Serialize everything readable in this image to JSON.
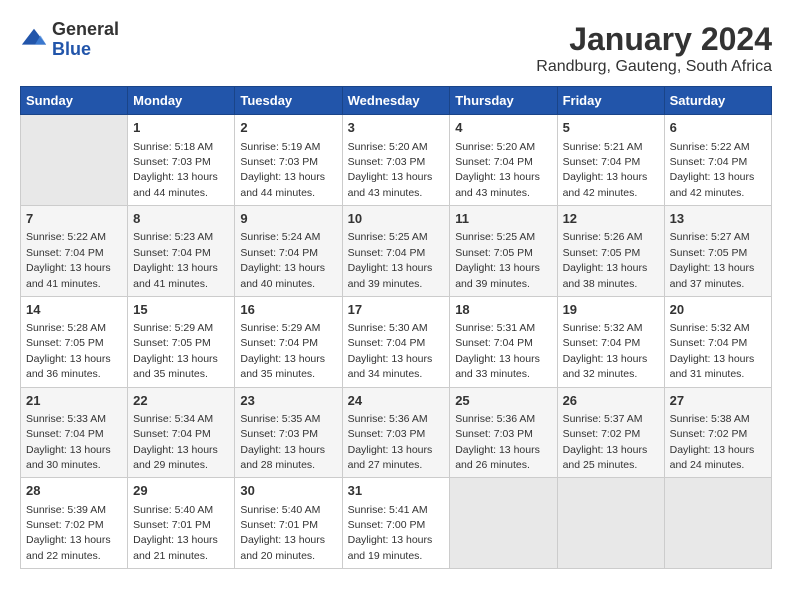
{
  "logo": {
    "general": "General",
    "blue": "Blue"
  },
  "title": "January 2024",
  "subtitle": "Randburg, Gauteng, South Africa",
  "days_header": [
    "Sunday",
    "Monday",
    "Tuesday",
    "Wednesday",
    "Thursday",
    "Friday",
    "Saturday"
  ],
  "weeks": [
    [
      {
        "day": "",
        "empty": true
      },
      {
        "day": "1",
        "sunrise": "Sunrise: 5:18 AM",
        "sunset": "Sunset: 7:03 PM",
        "daylight": "Daylight: 13 hours and 44 minutes."
      },
      {
        "day": "2",
        "sunrise": "Sunrise: 5:19 AM",
        "sunset": "Sunset: 7:03 PM",
        "daylight": "Daylight: 13 hours and 44 minutes."
      },
      {
        "day": "3",
        "sunrise": "Sunrise: 5:20 AM",
        "sunset": "Sunset: 7:03 PM",
        "daylight": "Daylight: 13 hours and 43 minutes."
      },
      {
        "day": "4",
        "sunrise": "Sunrise: 5:20 AM",
        "sunset": "Sunset: 7:04 PM",
        "daylight": "Daylight: 13 hours and 43 minutes."
      },
      {
        "day": "5",
        "sunrise": "Sunrise: 5:21 AM",
        "sunset": "Sunset: 7:04 PM",
        "daylight": "Daylight: 13 hours and 42 minutes."
      },
      {
        "day": "6",
        "sunrise": "Sunrise: 5:22 AM",
        "sunset": "Sunset: 7:04 PM",
        "daylight": "Daylight: 13 hours and 42 minutes."
      }
    ],
    [
      {
        "day": "7",
        "sunrise": "Sunrise: 5:22 AM",
        "sunset": "Sunset: 7:04 PM",
        "daylight": "Daylight: 13 hours and 41 minutes."
      },
      {
        "day": "8",
        "sunrise": "Sunrise: 5:23 AM",
        "sunset": "Sunset: 7:04 PM",
        "daylight": "Daylight: 13 hours and 41 minutes."
      },
      {
        "day": "9",
        "sunrise": "Sunrise: 5:24 AM",
        "sunset": "Sunset: 7:04 PM",
        "daylight": "Daylight: 13 hours and 40 minutes."
      },
      {
        "day": "10",
        "sunrise": "Sunrise: 5:25 AM",
        "sunset": "Sunset: 7:04 PM",
        "daylight": "Daylight: 13 hours and 39 minutes."
      },
      {
        "day": "11",
        "sunrise": "Sunrise: 5:25 AM",
        "sunset": "Sunset: 7:05 PM",
        "daylight": "Daylight: 13 hours and 39 minutes."
      },
      {
        "day": "12",
        "sunrise": "Sunrise: 5:26 AM",
        "sunset": "Sunset: 7:05 PM",
        "daylight": "Daylight: 13 hours and 38 minutes."
      },
      {
        "day": "13",
        "sunrise": "Sunrise: 5:27 AM",
        "sunset": "Sunset: 7:05 PM",
        "daylight": "Daylight: 13 hours and 37 minutes."
      }
    ],
    [
      {
        "day": "14",
        "sunrise": "Sunrise: 5:28 AM",
        "sunset": "Sunset: 7:05 PM",
        "daylight": "Daylight: 13 hours and 36 minutes."
      },
      {
        "day": "15",
        "sunrise": "Sunrise: 5:29 AM",
        "sunset": "Sunset: 7:05 PM",
        "daylight": "Daylight: 13 hours and 35 minutes."
      },
      {
        "day": "16",
        "sunrise": "Sunrise: 5:29 AM",
        "sunset": "Sunset: 7:04 PM",
        "daylight": "Daylight: 13 hours and 35 minutes."
      },
      {
        "day": "17",
        "sunrise": "Sunrise: 5:30 AM",
        "sunset": "Sunset: 7:04 PM",
        "daylight": "Daylight: 13 hours and 34 minutes."
      },
      {
        "day": "18",
        "sunrise": "Sunrise: 5:31 AM",
        "sunset": "Sunset: 7:04 PM",
        "daylight": "Daylight: 13 hours and 33 minutes."
      },
      {
        "day": "19",
        "sunrise": "Sunrise: 5:32 AM",
        "sunset": "Sunset: 7:04 PM",
        "daylight": "Daylight: 13 hours and 32 minutes."
      },
      {
        "day": "20",
        "sunrise": "Sunrise: 5:32 AM",
        "sunset": "Sunset: 7:04 PM",
        "daylight": "Daylight: 13 hours and 31 minutes."
      }
    ],
    [
      {
        "day": "21",
        "sunrise": "Sunrise: 5:33 AM",
        "sunset": "Sunset: 7:04 PM",
        "daylight": "Daylight: 13 hours and 30 minutes."
      },
      {
        "day": "22",
        "sunrise": "Sunrise: 5:34 AM",
        "sunset": "Sunset: 7:04 PM",
        "daylight": "Daylight: 13 hours and 29 minutes."
      },
      {
        "day": "23",
        "sunrise": "Sunrise: 5:35 AM",
        "sunset": "Sunset: 7:03 PM",
        "daylight": "Daylight: 13 hours and 28 minutes."
      },
      {
        "day": "24",
        "sunrise": "Sunrise: 5:36 AM",
        "sunset": "Sunset: 7:03 PM",
        "daylight": "Daylight: 13 hours and 27 minutes."
      },
      {
        "day": "25",
        "sunrise": "Sunrise: 5:36 AM",
        "sunset": "Sunset: 7:03 PM",
        "daylight": "Daylight: 13 hours and 26 minutes."
      },
      {
        "day": "26",
        "sunrise": "Sunrise: 5:37 AM",
        "sunset": "Sunset: 7:02 PM",
        "daylight": "Daylight: 13 hours and 25 minutes."
      },
      {
        "day": "27",
        "sunrise": "Sunrise: 5:38 AM",
        "sunset": "Sunset: 7:02 PM",
        "daylight": "Daylight: 13 hours and 24 minutes."
      }
    ],
    [
      {
        "day": "28",
        "sunrise": "Sunrise: 5:39 AM",
        "sunset": "Sunset: 7:02 PM",
        "daylight": "Daylight: 13 hours and 22 minutes."
      },
      {
        "day": "29",
        "sunrise": "Sunrise: 5:40 AM",
        "sunset": "Sunset: 7:01 PM",
        "daylight": "Daylight: 13 hours and 21 minutes."
      },
      {
        "day": "30",
        "sunrise": "Sunrise: 5:40 AM",
        "sunset": "Sunset: 7:01 PM",
        "daylight": "Daylight: 13 hours and 20 minutes."
      },
      {
        "day": "31",
        "sunrise": "Sunrise: 5:41 AM",
        "sunset": "Sunset: 7:00 PM",
        "daylight": "Daylight: 13 hours and 19 minutes."
      },
      {
        "day": "",
        "empty": true
      },
      {
        "day": "",
        "empty": true
      },
      {
        "day": "",
        "empty": true
      }
    ]
  ]
}
